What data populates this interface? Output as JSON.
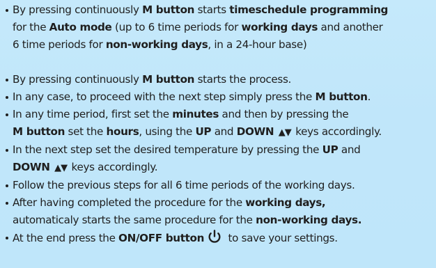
{
  "items": [
    {
      "lines": [
        [
          {
            "t": "By pressing continuously ",
            "b": false
          },
          {
            "t": "M button",
            "b": true
          },
          {
            "t": " starts ",
            "b": false
          },
          {
            "t": "timeschedule programming",
            "b": true
          }
        ],
        [
          {
            "t": "for the ",
            "b": false
          },
          {
            "t": "Auto mode",
            "b": true
          },
          {
            "t": " (up to 6 time periods for ",
            "b": false
          },
          {
            "t": "working days",
            "b": true
          },
          {
            "t": " and another",
            "b": false
          }
        ],
        [
          {
            "t": "6 time periods for ",
            "b": false
          },
          {
            "t": "non-working days",
            "b": true
          },
          {
            "t": ", in a 24-hour base)",
            "b": false
          }
        ]
      ]
    },
    {
      "lines": [
        [
          {
            "t": "By pressing continuously ",
            "b": false
          },
          {
            "t": "M button",
            "b": true
          },
          {
            "t": " starts the process.",
            "b": false
          }
        ]
      ]
    },
    {
      "lines": [
        [
          {
            "t": "In any case, to proceed with the next step simply press the ",
            "b": false
          },
          {
            "t": "M button",
            "b": true
          },
          {
            "t": ".",
            "b": false
          }
        ]
      ]
    },
    {
      "lines": [
        [
          {
            "t": "In any time period, first set the ",
            "b": false
          },
          {
            "t": "minutes",
            "b": true
          },
          {
            "t": " and then by pressing the",
            "b": false
          }
        ],
        [
          {
            "t": "M button",
            "b": true
          },
          {
            "t": " set the ",
            "b": false
          },
          {
            "t": "hours",
            "b": true
          },
          {
            "t": ", using the ",
            "b": false
          },
          {
            "t": "UP",
            "b": true
          },
          {
            "t": " and ",
            "b": false
          },
          {
            "t": "DOWN",
            "b": true
          },
          {
            "t": " ",
            "b": false
          },
          {
            "t": "▲▼",
            "b": true,
            "arrows": true
          },
          {
            "t": " keys accordingly.",
            "b": false
          }
        ]
      ]
    },
    {
      "lines": [
        [
          {
            "t": "In the next step set the desired temperature by pressing the ",
            "b": false
          },
          {
            "t": "UP",
            "b": true
          },
          {
            "t": " and",
            "b": false
          }
        ],
        [
          {
            "t": "DOWN",
            "b": true
          },
          {
            "t": " ",
            "b": false
          },
          {
            "t": "▲▼",
            "b": true,
            "arrows": true
          },
          {
            "t": " keys accordingly.",
            "b": false
          }
        ]
      ]
    },
    {
      "lines": [
        [
          {
            "t": "Follow the previous steps for all 6 time periods of the working days.",
            "b": false
          }
        ]
      ]
    },
    {
      "lines": [
        [
          {
            "t": "After having completed the procedure for the ",
            "b": false
          },
          {
            "t": "working days,",
            "b": true
          }
        ],
        [
          {
            "t": "automaticaly starts the same procedure for the ",
            "b": false
          },
          {
            "t": "non-working days.",
            "b": true
          }
        ]
      ]
    },
    {
      "lines": [
        [
          {
            "t": "At the end press the ",
            "b": false
          },
          {
            "t": "ON/OFF button",
            "b": true
          },
          {
            "t": "",
            "b": false,
            "icon": "power-icon"
          },
          {
            "t": " to save your settings.",
            "b": false
          }
        ]
      ]
    }
  ]
}
